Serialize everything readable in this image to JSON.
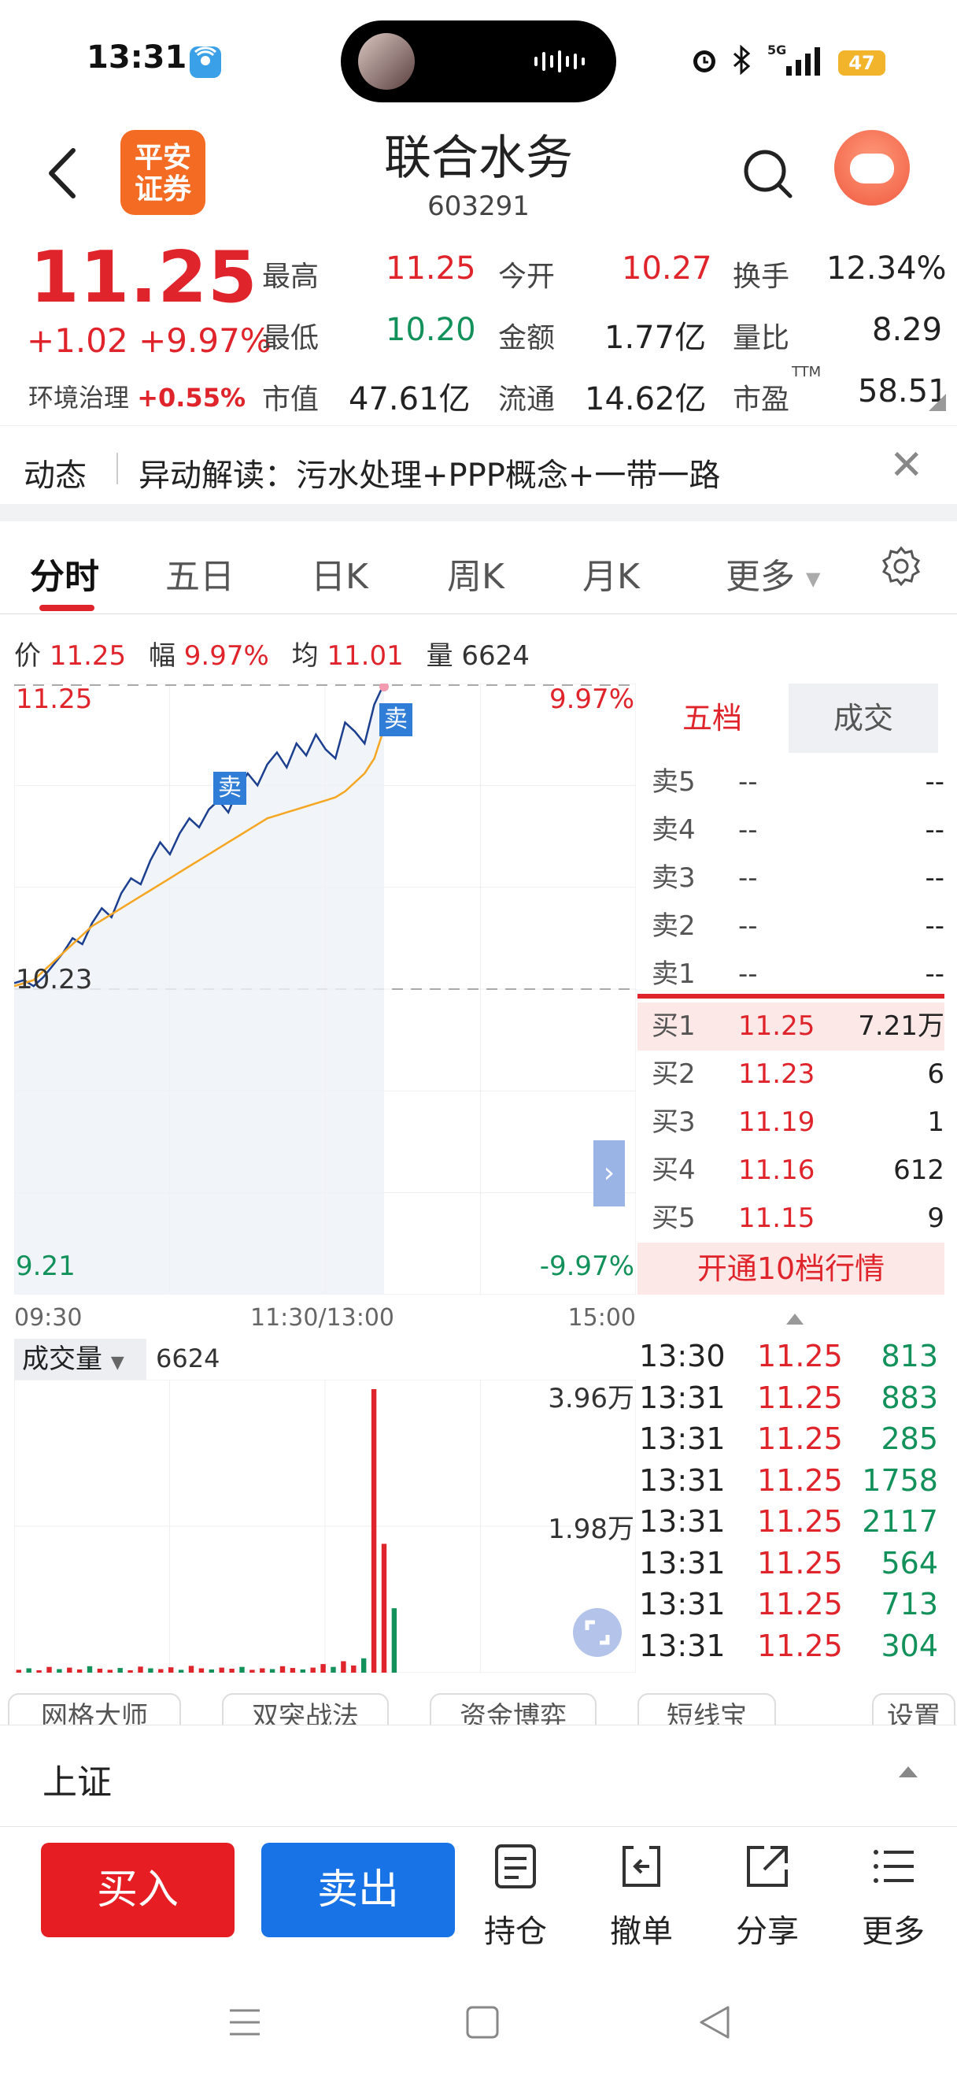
{
  "status": {
    "time": "13:31",
    "battery": "47",
    "network": "5G"
  },
  "header": {
    "logo_line1": "平安",
    "logo_line2": "证券",
    "title": "联合水务",
    "code": "603291"
  },
  "quote": {
    "price": "11.25",
    "change": "+1.02",
    "change_pct": "+9.97%",
    "sector_name": "环境治理",
    "sector_pct": "+0.55%",
    "labels": {
      "high": "最高",
      "open": "今开",
      "turnover": "换手",
      "low": "最低",
      "amount": "金额",
      "vol_ratio": "量比",
      "mktcap": "市值",
      "float": "流通",
      "pe": "市盈",
      "pe_sup": "TTM"
    },
    "values": {
      "high": "11.25",
      "open": "10.27",
      "turnover": "12.34%",
      "low": "10.20",
      "amount": "1.77亿",
      "vol_ratio": "8.29",
      "mktcap": "47.61亿",
      "float": "14.62亿",
      "pe": "58.51"
    }
  },
  "news": {
    "tag": "动态",
    "text": "异动解读：污水处理+PPP概念+一带一路"
  },
  "tabs": [
    "分时",
    "五日",
    "日K",
    "周K",
    "月K",
    "更多"
  ],
  "info": {
    "price_label": "价",
    "price": "11.25",
    "amp_label": "幅",
    "amp": "9.97%",
    "avg_label": "均",
    "avg": "11.01",
    "vol_label": "量",
    "vol": "6624"
  },
  "chart_data": {
    "type": "line",
    "y_max_label": "11.25",
    "y_max_pct": "9.97%",
    "y_mid_label": "10.23",
    "y_min_label": "9.21",
    "y_min_pct": "-9.97%",
    "ylim": [
      9.21,
      11.25
    ],
    "x_labels": [
      "09:30",
      "11:30/13:00",
      "15:00"
    ],
    "series": [
      {
        "values": [
          10.25,
          10.26,
          10.24,
          10.27,
          10.31,
          10.35,
          10.4,
          10.38,
          10.45,
          10.5,
          10.47,
          10.55,
          10.6,
          10.58,
          10.66,
          10.72,
          10.68,
          10.75,
          10.8,
          10.77,
          10.83,
          10.86,
          10.82,
          10.9,
          10.95,
          10.91,
          10.98,
          11.02,
          10.97,
          11.05,
          11.01,
          11.08,
          11.03,
          11.0,
          11.12,
          11.09,
          11.05,
          11.18,
          11.25
        ]
      },
      {
        "values": [
          10.24,
          10.25,
          10.26,
          10.29,
          10.32,
          10.35,
          10.38,
          10.41,
          10.44,
          10.46,
          10.48,
          10.5,
          10.52,
          10.54,
          10.56,
          10.58,
          10.6,
          10.62,
          10.64,
          10.66,
          10.68,
          10.7,
          10.72,
          10.74,
          10.76,
          10.78,
          10.8,
          10.81,
          10.82,
          10.83,
          10.84,
          10.85,
          10.86,
          10.87,
          10.89,
          10.92,
          10.95,
          11.0,
          11.1
        ]
      }
    ],
    "markers": [
      "卖",
      "卖"
    ]
  },
  "volume": {
    "label": "成交量",
    "value": "6624",
    "max_label": "3.96万",
    "mid_label": "1.98万",
    "bars": [
      40,
      60,
      30,
      80,
      50,
      70,
      45,
      90,
      55,
      40,
      65,
      30,
      85,
      60,
      50,
      75,
      40,
      95,
      60,
      45,
      70,
      55,
      80,
      40,
      60,
      50,
      90,
      65,
      45,
      70,
      120,
      80,
      160,
      100,
      200,
      3960,
      1800,
      900
    ]
  },
  "book": {
    "tab_active": "五档",
    "tab_other": "成交",
    "sells": [
      {
        "label": "卖5",
        "price": "--",
        "vol": "--"
      },
      {
        "label": "卖4",
        "price": "--",
        "vol": "--"
      },
      {
        "label": "卖3",
        "price": "--",
        "vol": "--"
      },
      {
        "label": "卖2",
        "price": "--",
        "vol": "--"
      },
      {
        "label": "卖1",
        "price": "--",
        "vol": "--"
      }
    ],
    "buys": [
      {
        "label": "买1",
        "price": "11.25",
        "vol": "7.21万"
      },
      {
        "label": "买2",
        "price": "11.23",
        "vol": "6"
      },
      {
        "label": "买3",
        "price": "11.19",
        "vol": "1"
      },
      {
        "label": "买4",
        "price": "11.16",
        "vol": "612"
      },
      {
        "label": "买5",
        "price": "11.15",
        "vol": "9"
      }
    ],
    "open10": "开通10档行情"
  },
  "ticks": [
    {
      "t": "13:30",
      "p": "11.25",
      "v": "813"
    },
    {
      "t": "13:31",
      "p": "11.25",
      "v": "883"
    },
    {
      "t": "13:31",
      "p": "11.25",
      "v": "285"
    },
    {
      "t": "13:31",
      "p": "11.25",
      "v": "1758"
    },
    {
      "t": "13:31",
      "p": "11.25",
      "v": "2117"
    },
    {
      "t": "13:31",
      "p": "11.25",
      "v": "564"
    },
    {
      "t": "13:31",
      "p": "11.25",
      "v": "713"
    },
    {
      "t": "13:31",
      "p": "11.25",
      "v": "304"
    }
  ],
  "tools": [
    "网格大师",
    "双突战法",
    "资金博弈",
    "短线宝",
    "设置"
  ],
  "market": {
    "name": "上证"
  },
  "bottom": {
    "buy": "买入",
    "sell": "卖出",
    "hold": "持仓",
    "cancel": "撤单",
    "share": "分享",
    "more": "更多"
  },
  "colors": {
    "up": "#e0242b",
    "down": "#12915a",
    "buy": "#e61e24",
    "sell": "#1873e6",
    "price_line": "#1c3f8f",
    "avg_line": "#f5a623"
  }
}
